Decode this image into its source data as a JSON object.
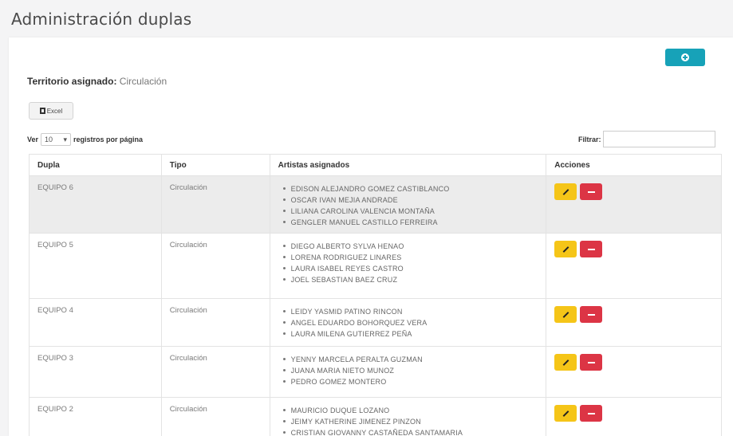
{
  "page": {
    "title": "Administración duplas"
  },
  "territory": {
    "label": "Territorio asignado:",
    "value": "Circulación"
  },
  "toolbar": {
    "excel_label": "Excel",
    "add_icon": "plus-circle-icon"
  },
  "length_control": {
    "prefix": "Ver",
    "value": "10",
    "suffix": "registros por página"
  },
  "filter": {
    "label": "Filtrar:",
    "value": ""
  },
  "table": {
    "headers": [
      "Dupla",
      "Tipo",
      "Artistas asignados",
      "Acciones"
    ],
    "rows": [
      {
        "dupla": "EQUIPO 6",
        "tipo": "Circulación",
        "artists": [
          "EDISON ALEJANDRO GOMEZ CASTIBLANCO",
          "OSCAR IVAN MEJIA ANDRADE",
          "LILIANA CAROLINA VALENCIA MONTAÑA",
          "GENGLER MANUEL CASTILLO FERREIRA"
        ]
      },
      {
        "dupla": "EQUIPO 5",
        "tipo": "Circulación",
        "artists": [
          "DIEGO ALBERTO SYLVA HENAO",
          "LORENA RODRIGUEZ LINARES",
          "LAURA ISABEL REYES CASTRO",
          "JOEL SEBASTIAN BAEZ CRUZ"
        ]
      },
      {
        "dupla": "EQUIPO 4",
        "tipo": "Circulación",
        "artists": [
          "LEIDY YASMID PATINO RINCON",
          "ANGEL EDUARDO BOHORQUEZ VERA",
          "LAURA MILENA GUTIERREZ PEÑA"
        ]
      },
      {
        "dupla": "EQUIPO 3",
        "tipo": "Circulación",
        "artists": [
          "YENNY MARCELA PERALTA GUZMAN",
          "JUANA MARIA NIETO MUNOZ",
          "PEDRO GOMEZ MONTERO"
        ]
      },
      {
        "dupla": "EQUIPO 2",
        "tipo": "Circulación",
        "artists": [
          "MAURICIO DUQUE LOZANO",
          "JEIMY KATHERINE JIMENEZ PINZON",
          "CRISTIAN GIOVANNY CASTAÑEDA SANTAMARIA"
        ]
      }
    ]
  },
  "colors": {
    "accent": "#17a2b8",
    "edit": "#f5c518",
    "delete": "#dc3545"
  }
}
